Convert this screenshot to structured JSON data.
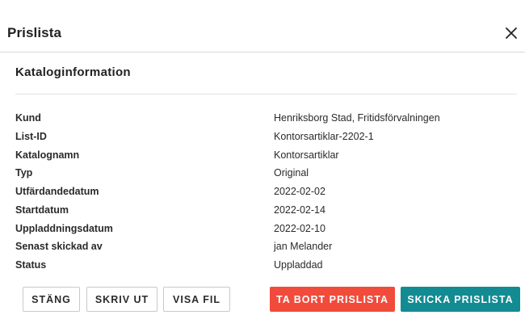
{
  "dialog": {
    "title": "Prislista",
    "close_icon": "close-icon"
  },
  "section": {
    "title": "Kataloginformation"
  },
  "fields": [
    {
      "label": "Kund",
      "value": "Henriksborg Stad, Fritidsförvalningen"
    },
    {
      "label": "List-ID",
      "value": "Kontorsartiklar-2202-1"
    },
    {
      "label": "Katalognamn",
      "value": "Kontorsartiklar"
    },
    {
      "label": "Typ",
      "value": "Original"
    },
    {
      "label": "Utfärdandedatum",
      "value": "2022-02-02"
    },
    {
      "label": "Startdatum",
      "value": "2022-02-14"
    },
    {
      "label": "Uppladdningsdatum",
      "value": "2022-02-10"
    },
    {
      "label": "Senast skickad av",
      "value": "jan Melander"
    },
    {
      "label": "Status",
      "value": "Uppladdad"
    }
  ],
  "buttons": {
    "close_label": "STÄNG",
    "print_label": "SKRIV UT",
    "show_file_label": "VISA FIL",
    "delete_label": "TA BORT PRISLISTA",
    "send_label": "SKICKA PRISLISTA"
  },
  "colors": {
    "delete": "#f14b3c",
    "send": "#138b93"
  }
}
